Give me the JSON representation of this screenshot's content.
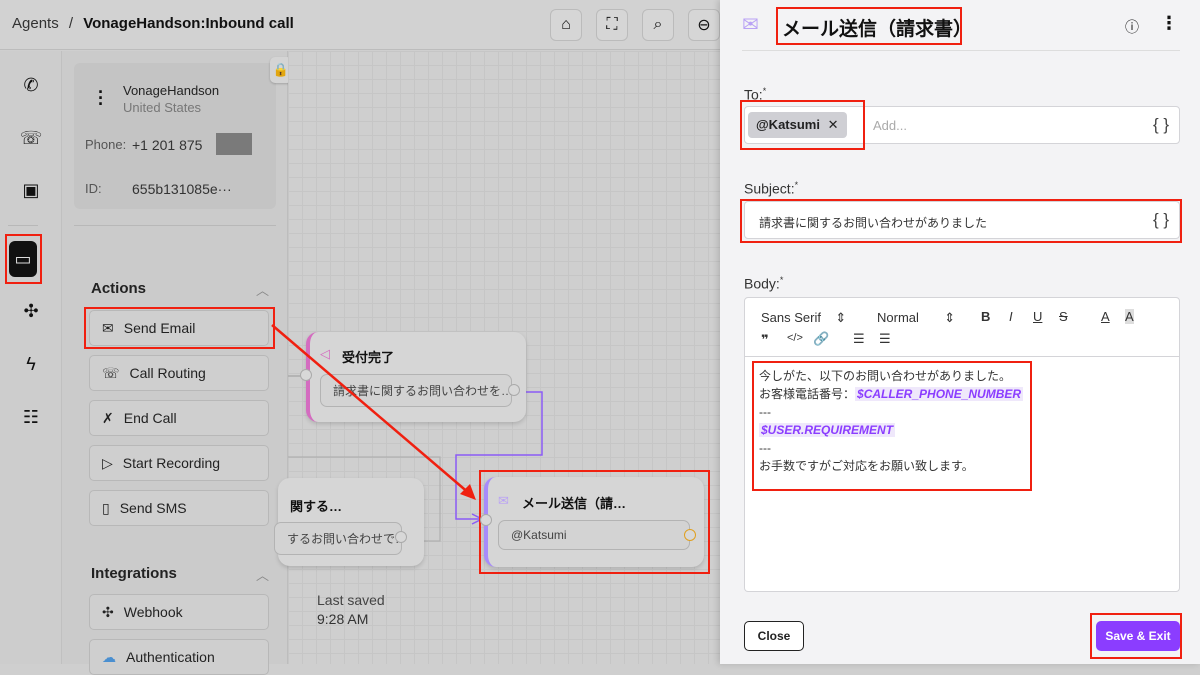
{
  "breadcrumb": {
    "root": "Agents",
    "separator": "/",
    "current": "VonageHandson:Inbound call"
  },
  "toolbar": [
    {
      "icon": "home-icon",
      "glyph": "⌂"
    },
    {
      "icon": "fullscreen-icon",
      "glyph": "⛶"
    },
    {
      "icon": "zoom-fit-icon",
      "glyph": "⌕"
    },
    {
      "icon": "zoom-out-icon",
      "glyph": "⊖"
    }
  ],
  "rail": [
    {
      "icon": "phone-call-icon",
      "glyph": "✆"
    },
    {
      "icon": "phone-number-icon",
      "glyph": "☏"
    },
    {
      "icon": "id-badge-icon",
      "glyph": "▣"
    },
    {
      "icon": "flow-panel-icon",
      "glyph": "▭",
      "active": true
    },
    {
      "icon": "integration-icon",
      "glyph": "✣"
    },
    {
      "icon": "lightning-icon",
      "glyph": "ϟ"
    },
    {
      "icon": "tree-icon",
      "glyph": "☷"
    }
  ],
  "agent": {
    "name": "VonageHandson",
    "country": "United States",
    "phone_label": "Phone:",
    "phone": "+1 201 875",
    "id_label": "ID:",
    "id": "655b131085e···"
  },
  "actions": {
    "title": "Actions",
    "items": [
      {
        "label": "Send Email",
        "glyph": "✉"
      },
      {
        "label": "Call Routing",
        "glyph": "☏"
      },
      {
        "label": "End Call",
        "glyph": "✗"
      },
      {
        "label": "Start Recording",
        "glyph": "▷"
      },
      {
        "label": "Send SMS",
        "glyph": "▯"
      }
    ]
  },
  "integrations": {
    "title": "Integrations",
    "items": [
      {
        "label": "Webhook",
        "glyph": "✣"
      },
      {
        "label": "Authentication",
        "glyph": "☁"
      }
    ]
  },
  "nodes": {
    "n1": {
      "title": "受付完了",
      "text": "請求書に関するお問い合わせを…"
    },
    "n2": {
      "title": "関する…",
      "text": "するお問い合わせで…"
    },
    "n3": {
      "title": "メール送信（請…",
      "text": "@Katsumi"
    }
  },
  "last_saved": {
    "label": "Last saved",
    "time": "9:28 AM"
  },
  "panel": {
    "title": "メール送信（請求書）",
    "to_label": "To:",
    "to_chip": "@Katsumi",
    "to_placeholder": "Add...",
    "var_btn": "{ }",
    "subject_label": "Subject:",
    "subject": "請求書に関するお問い合わせがありました",
    "body_label": "Body:",
    "font": "Sans Serif",
    "size": "Normal",
    "body_lines": [
      "今しがた、以下のお問い合わせがありました。",
      "お客様電話番号：",
      "$CALLER_PHONE_NUMBER",
      "---",
      "$USER.REQUIREMENT",
      "---",
      "お手数ですがご対応をお願い致します。"
    ],
    "close": "Close",
    "save": "Save & Exit"
  },
  "colors": {
    "accent": "#8b3dff",
    "annotation": "#f02010",
    "port_active": "#e0a020"
  }
}
